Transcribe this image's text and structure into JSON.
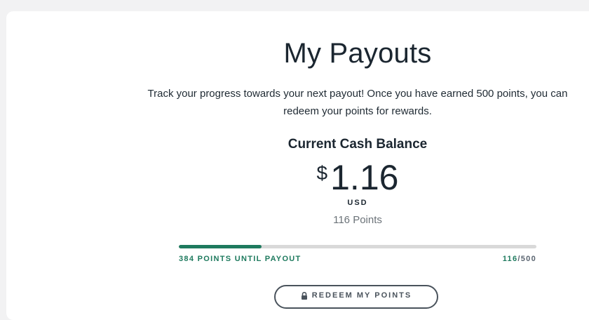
{
  "page": {
    "title": "My Payouts",
    "description": "Track your progress towards your next payout! Once you have earned 500 points, you can redeem your points for rewards."
  },
  "balance": {
    "label": "Current Cash Balance",
    "currency_symbol": "$",
    "amount": "1.16",
    "currency_code": "USD",
    "points_text": "116 Points"
  },
  "progress": {
    "until_payout_label": "384 POINTS UNTIL PAYOUT",
    "current": "116",
    "separator": "/",
    "max": "500",
    "fraction": 0.232,
    "fill_color": "#1e7a5e",
    "track_color": "#d9d9d9"
  },
  "actions": {
    "redeem_label": "REDEEM MY POINTS",
    "redeem_icon": "lock-icon"
  }
}
